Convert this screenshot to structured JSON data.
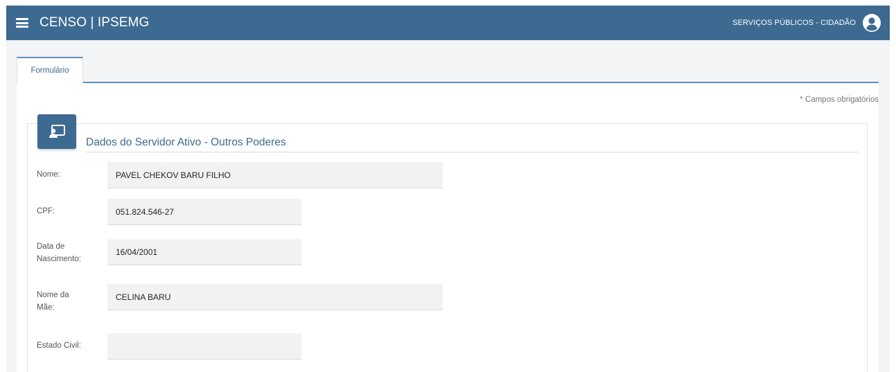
{
  "header": {
    "menu_icon": "hamburger-menu-icon",
    "title": "CENSO | IPSEMG",
    "services_link": "SERVIÇOS PÚBLICOS - CIDADÃO",
    "user_icon": "user-circle-icon",
    "background": "#3d6a91"
  },
  "tabs": [
    {
      "label": "Formulário",
      "active": true
    }
  ],
  "required_note": "* Campos obrigatórios",
  "section": {
    "icon": "person-card-icon",
    "title": "Dados do Servidor Ativo - Outros Poderes"
  },
  "fields": {
    "nome": {
      "label": "Nome:",
      "value": "PAVEL CHEKOV BARU FILHO"
    },
    "cpf": {
      "label": "CPF:",
      "value": "051.824.546-27"
    },
    "data_nascimento": {
      "label_line1": "Data de",
      "label_line2": "Nascimento:",
      "value": "16/04/2001"
    },
    "nome_mae": {
      "label_line1": "Nome da",
      "label_line2": "Mãe:",
      "value": "CELINA BARU"
    },
    "estado_civil": {
      "label": "Estado Civil:",
      "value": ""
    }
  },
  "colors": {
    "accent": "#3d6a91",
    "tab_border": "#5f8fbf",
    "field_background": "#f2f2f2"
  }
}
